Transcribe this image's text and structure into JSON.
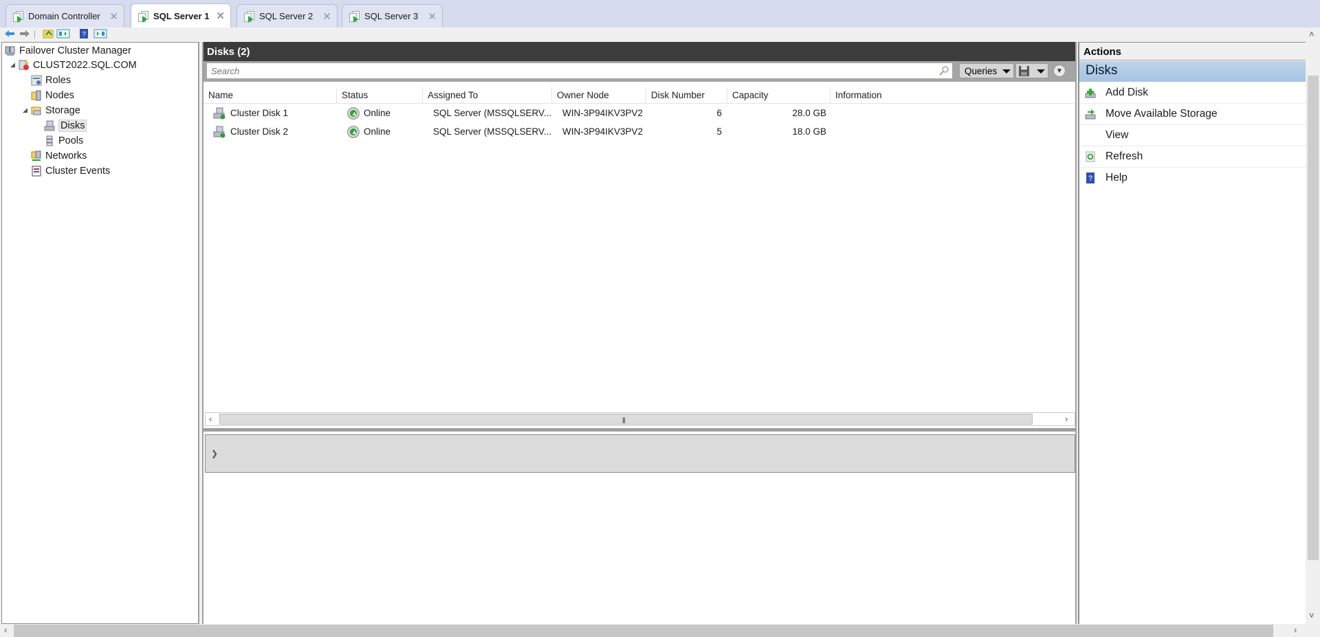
{
  "tabs": [
    {
      "label": "Domain Controller",
      "active": false
    },
    {
      "label": "SQL Server 1",
      "active": true
    },
    {
      "label": "SQL Server 2",
      "active": false
    },
    {
      "label": "SQL Server 3",
      "active": false
    }
  ],
  "toolbar": {
    "icons": [
      "back-arrow-icon",
      "forward-arrow-icon",
      "folder-up-icon",
      "show-hide-console-tree-icon",
      "help-icon",
      "show-hide-action-pane-icon"
    ]
  },
  "tree": {
    "root": "Failover Cluster Manager",
    "cluster": "CLUST2022.SQL.COM",
    "roles": "Roles",
    "nodes": "Nodes",
    "storage": "Storage",
    "disks": "Disks",
    "pools": "Pools",
    "networks": "Networks",
    "events": "Cluster Events"
  },
  "center": {
    "title": "Disks (2)",
    "search_placeholder": "Search",
    "queries_label": "Queries",
    "columns": [
      "Name",
      "Status",
      "Assigned To",
      "Owner Node",
      "Disk Number",
      "Capacity",
      "Information"
    ],
    "rows": [
      {
        "name": "Cluster Disk 1",
        "status": "Online",
        "assigned_to": "SQL Server (MSSQLSERV...",
        "owner_node": "WIN-3P94IKV3PV2",
        "disk_number": "6",
        "capacity": "28.0 GB",
        "information": ""
      },
      {
        "name": "Cluster Disk 2",
        "status": "Online",
        "assigned_to": "SQL Server (MSSQLSERV...",
        "owner_node": "WIN-3P94IKV3PV2",
        "disk_number": "5",
        "capacity": "18.0 GB",
        "information": ""
      }
    ]
  },
  "actions": {
    "header": "Actions",
    "section": "Disks",
    "items": [
      {
        "label": "Add Disk",
        "icon": "add-disk-icon"
      },
      {
        "label": "Move Available Storage",
        "icon": "move-storage-icon"
      },
      {
        "label": "View",
        "icon": ""
      },
      {
        "label": "Refresh",
        "icon": "refresh-icon"
      },
      {
        "label": "Help",
        "icon": "help-icon"
      }
    ]
  },
  "colors": {
    "tabbar_bg": "#d6dbef",
    "header_dark": "#3c3c3c",
    "actions_section": "#a6c3e2",
    "online_green": "#2f9e36"
  }
}
